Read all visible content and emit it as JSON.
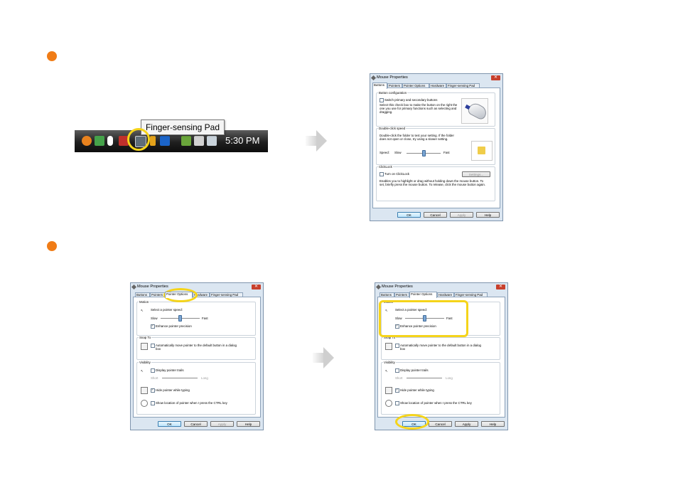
{
  "taskbar": {
    "tooltip": "Finger-sensing Pad",
    "clock": "5:30 PM"
  },
  "dialog": {
    "title": "Mouse Properties",
    "tabs": [
      "Buttons",
      "Pointers",
      "Pointer Options",
      "Hardware",
      "Finger-sensing Pad"
    ],
    "buttons": {
      "ok": "OK",
      "cancel": "Cancel",
      "apply": "Apply",
      "help": "Help"
    }
  },
  "buttons_tab": {
    "config_label": "Button configuration",
    "switch_label": "Switch primary and secondary buttons",
    "switch_desc": "Select this check box to make the button on the right the one you use for primary functions such as selecting and dragging.",
    "dblclick_label": "Double-click speed",
    "dblclick_desc": "Double-click the folder to test your setting. If the folder does not open or close, try using a slower setting.",
    "speed_label": "Speed:",
    "slow": "Slow",
    "fast": "Fast",
    "clicklock_label": "ClickLock",
    "clicklock_check": "Turn on ClickLock",
    "settings_btn": "Settings...",
    "clicklock_desc": "Enables you to highlight or drag without holding down the mouse button. To set, briefly press the mouse button. To release, click the mouse button again."
  },
  "pointer_tab": {
    "motion_label": "Motion",
    "speed_prompt": "Select a pointer speed:",
    "slow": "Slow",
    "fast": "Fast",
    "precision": "Enhance pointer precision",
    "snap_label": "Snap To",
    "snap_check": "Automatically move pointer to the default button in a dialog box",
    "visibility_label": "Visibility",
    "trails": "Display pointer trails",
    "short": "Short",
    "long": "Long",
    "hide": "Hide pointer while typing",
    "show_ctrl": "Show location of pointer when I press the CTRL key"
  },
  "state": {
    "switch_primary": false,
    "clicklock": false,
    "enhance_precision": true,
    "snap_to": false,
    "pointer_trails": false,
    "hide_typing": true,
    "show_ctrl": false,
    "double_click_speed_fraction": 0.5,
    "pointer_speed_fraction": 0.5
  },
  "colors": {
    "bullet": "#f07c16",
    "highlight": "#f5d41a"
  }
}
